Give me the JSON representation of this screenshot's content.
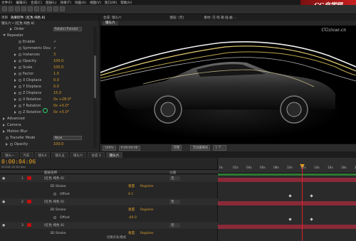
{
  "menu": [
    "文件(F)",
    "编辑(E)",
    "合成(C)",
    "图层(L)",
    "效果(T)",
    "动画(A)",
    "视图(V)",
    "窗口(W)",
    "帮助(H)"
  ],
  "watermark": "CG自学网",
  "left_panel": {
    "tabs": [
      "项目",
      "效果控件: [红色 纯色 8]"
    ],
    "breadcrumb": "镜头六 • [红色 纯色 8]",
    "rows": [
      {
        "label": "Order",
        "indent": 14,
        "tw": "r",
        "dd": "Rotate>Translat"
      },
      {
        "label": "Repeater",
        "indent": 4,
        "tw": "d"
      },
      {
        "label": "Enable",
        "indent": 26,
        "sw": true,
        "check": "✓"
      },
      {
        "label": "Symmetric Dou",
        "indent": 26,
        "sw": true,
        "check": "✓"
      },
      {
        "label": "Instances",
        "indent": 20,
        "tw": "r",
        "sw": true,
        "val": "3"
      },
      {
        "label": "Opacity",
        "indent": 20,
        "tw": "r",
        "sw": true,
        "val": "100.0"
      },
      {
        "label": "Scale",
        "indent": 20,
        "tw": "r",
        "sw": true,
        "val": "100.0"
      },
      {
        "label": "Factor",
        "indent": 20,
        "tw": "r",
        "sw": true,
        "val": "1.0"
      },
      {
        "label": "X Displace",
        "indent": 20,
        "tw": "r",
        "sw": true,
        "val": "0.0"
      },
      {
        "label": "Y Displace",
        "indent": 20,
        "tw": "r",
        "sw": true,
        "val": "0.0"
      },
      {
        "label": "Z Displace",
        "indent": 20,
        "tw": "r",
        "sw": true,
        "val": "15.0"
      },
      {
        "label": "X Rotation",
        "indent": 20,
        "tw": "r",
        "sw": true,
        "val": "0x +28.0°"
      },
      {
        "label": "Y Rotation",
        "indent": 20,
        "tw": "r",
        "sw": true,
        "val": "0x +0.0°"
      },
      {
        "label": "Z Rotation",
        "indent": 20,
        "tw": "r",
        "sw": true,
        "val": "0x +5.0°"
      },
      {
        "label": "Advanced",
        "indent": 4,
        "tw": "r"
      },
      {
        "label": "Camera",
        "indent": 4,
        "tw": "r"
      },
      {
        "label": "Motion Blur",
        "indent": 4,
        "tw": "r"
      },
      {
        "label": "Transfer Mode",
        "indent": 8,
        "sw": true,
        "dd": "None"
      },
      {
        "label": "Opacity",
        "indent": 8,
        "tw": "r",
        "sw": true,
        "val": "100.0"
      }
    ]
  },
  "comp": {
    "title": "合成: 镜头六",
    "layer": "图层: (无)",
    "footage": "素材: 在 暗 箱 插 曲 ...",
    "tab": "镜头六",
    "viewer_watermark": "CGzixue.cn",
    "bar": [
      "100%",
      "0:00:04:06",
      "完整",
      "活动摄像机",
      "1 个..."
    ]
  },
  "timeline_tabs": [
    {
      "label": "镜头一"
    },
    {
      "label": "汽车"
    },
    {
      "label": "镜头4"
    },
    {
      "label": "镜头五"
    },
    {
      "label": "镜头六"
    },
    {
      "label": "合成 3"
    },
    {
      "label": "镜头六",
      "active": true
    }
  ],
  "timeline": {
    "time": "0:00:04:06",
    "frames": "00106 (25.00 fps)",
    "col_name": "图层名称",
    "col_parent": "父级",
    "ruler": [
      "0s",
      "02s",
      "04s",
      "06s",
      "08s",
      "10s",
      "12s",
      "14s",
      "16s",
      "18s",
      "20s"
    ],
    "rows": [
      {
        "num": "1",
        "name": "[红色 纯色 8]",
        "parent": "无",
        "type": "layer"
      },
      {
        "label": "3D Stroke",
        "type": "effect"
      },
      {
        "label": "Offset",
        "val": "0.1",
        "type": "prop"
      },
      {
        "num": "2",
        "name": "[红色 纯色 8]",
        "parent": "无",
        "type": "layer"
      },
      {
        "label": "3D Stroke",
        "type": "effect"
      },
      {
        "label": "Offset",
        "val": "-40.0",
        "type": "prop"
      },
      {
        "num": "3",
        "name": "[红色 纯色 8]",
        "parent": "无",
        "type": "layer"
      },
      {
        "label": "3D Stroke",
        "type": "effect"
      }
    ],
    "reset": "重置",
    "register": "Register",
    "footer": "切换开关/模式"
  }
}
